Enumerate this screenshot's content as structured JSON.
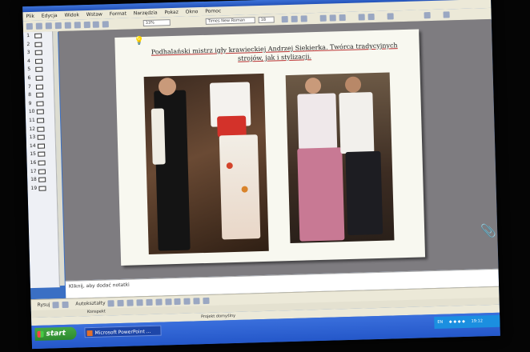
{
  "menu": [
    "Plik",
    "Edycja",
    "Widok",
    "Wstaw",
    "Format",
    "Narzędzia",
    "Pokaz",
    "Okno",
    "Pomoc"
  ],
  "toolbar": {
    "zoom": "33%",
    "font": "Times New Roman",
    "size": "18"
  },
  "outline_rows": [
    "1",
    "2",
    "3",
    "4",
    "5",
    "6",
    "7",
    "8",
    "9",
    "10",
    "11",
    "12",
    "13",
    "14",
    "15",
    "16",
    "17",
    "18",
    "19"
  ],
  "slide": {
    "title": "Podhalański mistrz igły krawieckiej Andrzej Siekierka. Twórca tradycyjnych strojów, jak i stylizacji."
  },
  "notes": {
    "placeholder": "Kliknij, aby dodać notatki"
  },
  "drawbar": {
    "draw": "Rysuj",
    "autoshapes": "Autokształty"
  },
  "viewtabs": {
    "outline": "Konspekt"
  },
  "status": {
    "design": "Projekt domyślny"
  },
  "taskbar": {
    "start": "start",
    "app": "Microsoft PowerPoint ...",
    "lang": "EN",
    "clock": "19:12"
  },
  "colors": {
    "taskbar": "#2457c9",
    "start": "#2d8a2d",
    "slide_bg": "#7e7c80"
  }
}
